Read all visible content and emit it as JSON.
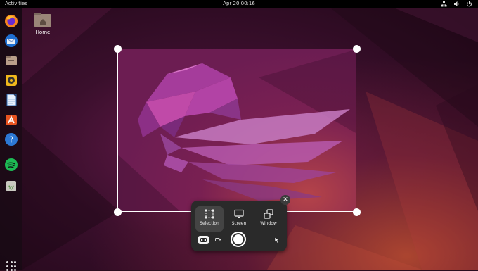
{
  "topbar": {
    "activities_label": "Activities",
    "clock": "Apr 20  00:16",
    "tray_icons": [
      "network-icon",
      "volume-icon",
      "power-icon"
    ]
  },
  "dock": {
    "items": [
      "firefox",
      "thunderbird",
      "files",
      "rhythmbox",
      "libreoffice-writer",
      "app-center",
      "help",
      "spotify",
      "trash"
    ],
    "app_grid_icon": "show-apps-icon"
  },
  "desktop": {
    "home_label": "Home"
  },
  "screenshot_panel": {
    "modes": [
      {
        "label": "Selection",
        "icon": "selection-icon",
        "active": true
      },
      {
        "label": "Screen",
        "icon": "screen-icon",
        "active": false
      },
      {
        "label": "Window",
        "icon": "window-icon",
        "active": false
      }
    ],
    "capture_type": "screenshot",
    "show_pointer": "pointer-icon",
    "close_icon": "close-icon"
  },
  "colors": {
    "panel_bg": "#2a2a2a",
    "wallpaper_base": "#5a1746",
    "accent_orange": "#e95420"
  }
}
